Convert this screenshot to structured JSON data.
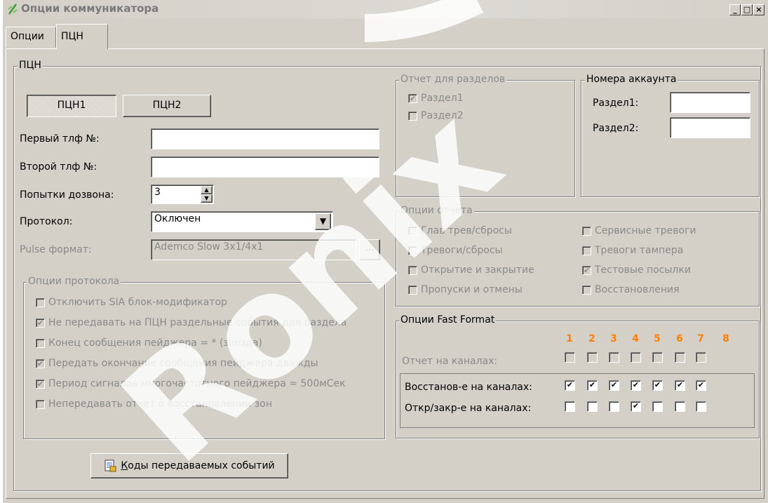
{
  "window": {
    "title": "Опции коммуникатора",
    "controls": [
      "_",
      "□",
      "×"
    ]
  },
  "tabs": [
    {
      "label": "Опции",
      "active": false
    },
    {
      "label": "ПЦН",
      "active": true
    }
  ],
  "pcn_group": {
    "label": "ПЦН",
    "pcn1": "ПЦН1",
    "pcn2": "ПЦН2",
    "first_phone_label": "Первый тлф №:",
    "first_phone_value": "",
    "second_phone_label": "Второй тлф №:",
    "second_phone_value": "",
    "attempts_label": "Попытки дозвона:",
    "attempts_value": "3",
    "protocol_label": "Протокол:",
    "protocol_value": "Оключен",
    "pulse_label": "Pulse формат:",
    "pulse_value": "Ademco Slow 3x1/4x1",
    "pulse_button": "..."
  },
  "protocol_options": {
    "label": "Опции протокола",
    "items": [
      {
        "label": "Отключить SIA блок-модификатор",
        "checked": false
      },
      {
        "label": "Не передавать на ПЦН раздельные события для раздела",
        "checked": true
      },
      {
        "label": "Конец сообщения пейджера = * (звезда)",
        "checked": false
      },
      {
        "label": "Передать окончание сообщения пейджера дважды",
        "checked": true
      },
      {
        "label": "Период сигналов многочастотного пейджера = 500мСек",
        "checked": true
      },
      {
        "label": "Непередавать отчет о восстановлении зон",
        "checked": false
      }
    ]
  },
  "codes_button": {
    "prefix": "К",
    "label": "оды передаваемых событий"
  },
  "section_report": {
    "label": "Отчет для разделов",
    "items": [
      {
        "label": "Раздел1",
        "checked": true
      },
      {
        "label": "Раздел2",
        "checked": false
      }
    ]
  },
  "account_numbers": {
    "label": "Номера аккаунта",
    "section1_label": "Раздел1:",
    "section1_value": "",
    "section2_label": "Раздел2:",
    "section2_value": ""
  },
  "report_options": {
    "label": "Опции отчета",
    "left": [
      {
        "label": "Глав трев/сбросы",
        "checked": false
      },
      {
        "label": "Тревоги/сбросы",
        "checked": false
      },
      {
        "label": "Открытие и закрытие",
        "checked": false
      },
      {
        "label": "Пропуски и отмены",
        "checked": false
      }
    ],
    "right": [
      {
        "label": "Сервисные тревоги",
        "checked": false
      },
      {
        "label": "Тревоги тампера",
        "checked": false
      },
      {
        "label": "Тестовые посылки",
        "checked": true
      },
      {
        "label": "Восстановления",
        "checked": false
      }
    ]
  },
  "fast_format": {
    "label": "Опции Fast Format",
    "channels": [
      "1",
      "2",
      "3",
      "4",
      "5",
      "6",
      "7",
      "8"
    ],
    "report_label": "Отчет на каналах:",
    "report_checked": [
      false,
      false,
      false,
      false,
      false,
      false,
      false
    ],
    "restore_label": "Восстанов-е на каналах:",
    "restore_checked": [
      true,
      true,
      true,
      true,
      true,
      true,
      true
    ],
    "openclose_label": "Откр/закр-е на каналах:",
    "openclose_checked": [
      false,
      false,
      false,
      true,
      false,
      false,
      false
    ]
  },
  "watermark": "Ronix"
}
